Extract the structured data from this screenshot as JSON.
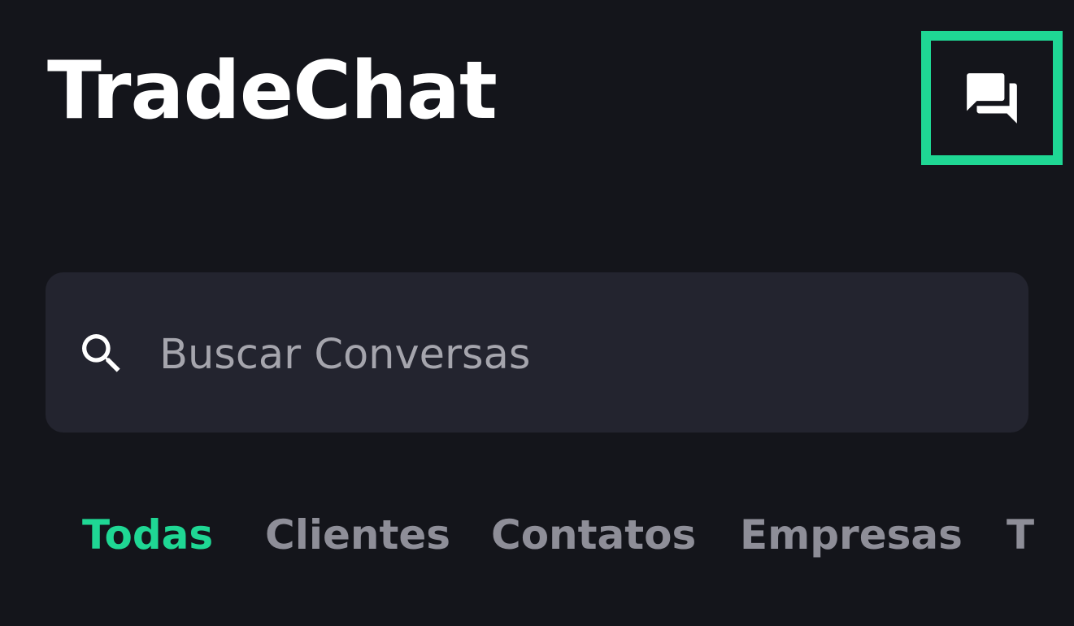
{
  "header": {
    "title": "TradeChat",
    "chat_icon": "chat-bubbles-icon"
  },
  "search": {
    "placeholder": "Buscar Conversas",
    "icon": "search-icon"
  },
  "tabs": [
    {
      "label": "Todas",
      "active": true
    },
    {
      "label": "Clientes",
      "active": false
    },
    {
      "label": "Contatos",
      "active": false
    },
    {
      "label": "Empresas",
      "active": false
    },
    {
      "label": "T",
      "active": false
    }
  ],
  "colors": {
    "accent": "#1fd794",
    "background": "#14151b",
    "search_background": "#23242f",
    "inactive_tab": "#8e8e98"
  }
}
